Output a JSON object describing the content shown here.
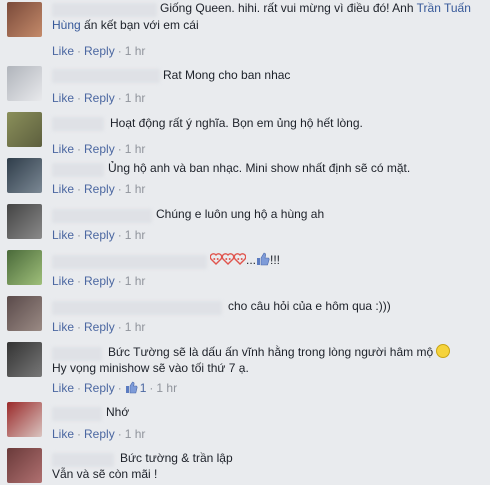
{
  "actions": {
    "like": "Like",
    "reply": "Reply",
    "time": "1 hr",
    "separator": "·"
  },
  "comments": [
    {
      "line1": "Giống Queen. hihi. rất vui mừng vì điều đó! Anh",
      "mention1": "Trần Tuấn",
      "mention2": "Hùng",
      "line2": "ấn kết bạn với em cái"
    },
    {
      "text": "Rat Mong cho ban nhac"
    },
    {
      "text": "Hoạt động rất ý nghĩa. Bọn em ủng hộ hết lòng."
    },
    {
      "text": "Ủng hộ anh và ban nhạc. Mini show nhất định sẽ có mặt."
    },
    {
      "text": "Chúng e luôn ung hộ a hùng ah"
    },
    {
      "text": "...",
      "suffix": "!!!",
      "emoji": [
        "heart-eyes-icon",
        "heart-eyes-icon",
        "heart-eyes-icon",
        "thumbs-up-icon"
      ]
    },
    {
      "text": "cho câu hỏi của e hôm qua :)))"
    },
    {
      "line1": "Bức Tường sẽ là dấu ấn vĩnh hằng trong lòng người hâm mộ",
      "line2": "Hy vọng minishow sẽ vào tối thứ 7 ạ.",
      "like_count": "1"
    },
    {
      "text": "Nhớ"
    },
    {
      "line1": "Bức tường & trần lập",
      "line2": "Vẫn và sẽ còn mãi !"
    }
  ],
  "colors": {
    "link": "#365899",
    "action": "#4b67a1",
    "meta": "#90949c",
    "background": "#e9ebee"
  }
}
